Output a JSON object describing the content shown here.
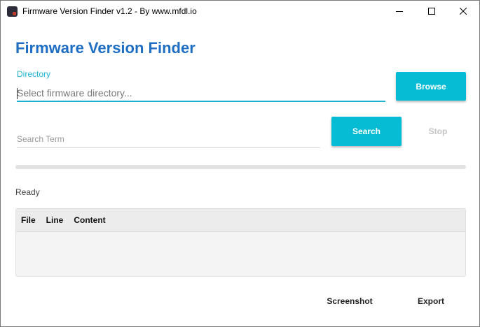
{
  "window": {
    "title": "Firmware Version Finder v1.2 - By www.mfdl.io"
  },
  "app": {
    "heading": "Firmware Version Finder"
  },
  "directory": {
    "label": "Directory",
    "placeholder": "Select firmware directory...",
    "value": "",
    "browse_label": "Browse"
  },
  "search": {
    "placeholder": "Search Term",
    "value": "",
    "search_label": "Search",
    "stop_label": "Stop"
  },
  "progress": {
    "value": 0
  },
  "status": {
    "text": "Ready"
  },
  "results": {
    "columns": [
      "File",
      "Line",
      "Content"
    ],
    "rows": []
  },
  "actions": {
    "screenshot_label": "Screenshot",
    "export_label": "Export"
  },
  "colors": {
    "accent": "#06bcd4",
    "heading": "#1e6fc4",
    "label": "#1fb4d6",
    "disabled": "#c4c4c4"
  },
  "icons": {
    "app": "app-icon",
    "minimize": "minimize-icon",
    "maximize": "maximize-icon",
    "close": "close-icon"
  }
}
